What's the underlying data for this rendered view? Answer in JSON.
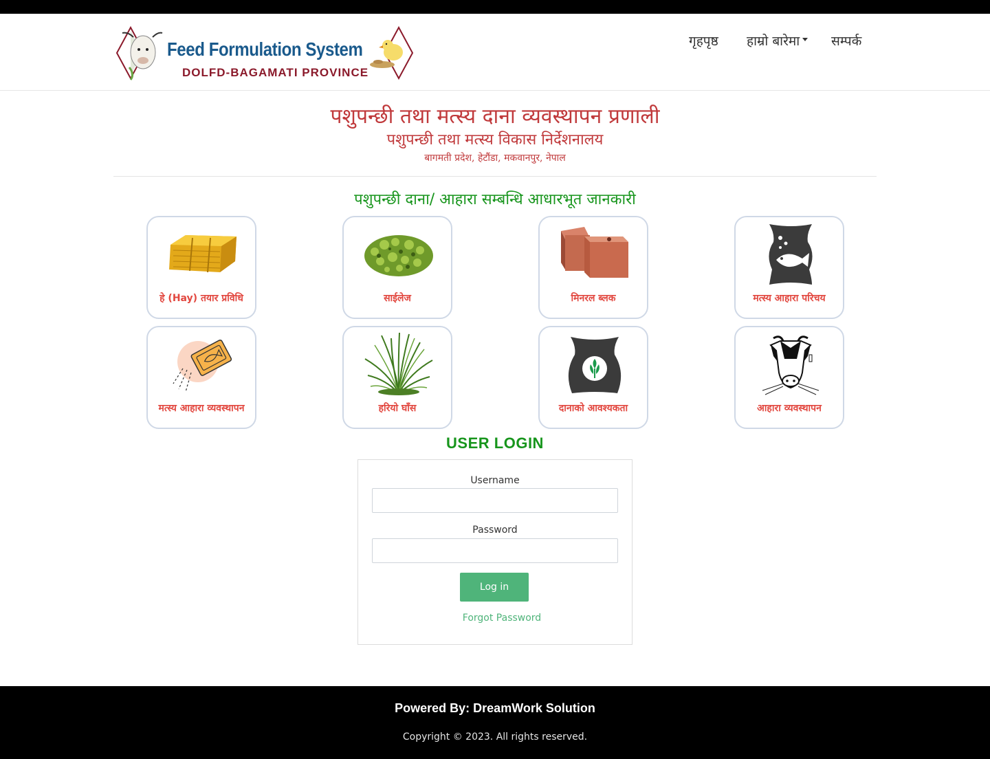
{
  "logo": {
    "title": "Feed Formulation System",
    "subtitle": "DOLFD-BAGAMATI PROVINCE"
  },
  "nav": {
    "home": "गृहपृष्ठ",
    "about": "हाम्रो बारेमा",
    "contact": "सम्पर्क"
  },
  "hero": {
    "title": "पशुपन्छी तथा मत्स्य दाना व्यवस्थापन प्रणाली",
    "subtitle": "पशुपन्छी तथा मत्स्य विकास निर्देशनालय",
    "address": "बागमती प्रदेश, हेटौंडा, मकवानपुर, नेपाल"
  },
  "section": {
    "title": "पशुपन्छी दाना/ आहारा सम्बन्धि आधारभूत जानकारी"
  },
  "cards": [
    {
      "label": "हे (Hay) तयार प्रविधि",
      "icon": "hay-bale-icon"
    },
    {
      "label": "साईलेज",
      "icon": "silage-icon"
    },
    {
      "label": "मिनरल ब्लक",
      "icon": "mineral-block-icon"
    },
    {
      "label": "मत्स्य आहारा परिचय",
      "icon": "fish-feed-bag-icon"
    },
    {
      "label": "मत्स्य आहारा व्यवस्थापन",
      "icon": "fish-feed-packet-icon"
    },
    {
      "label": "हरियो घाँस",
      "icon": "green-grass-icon"
    },
    {
      "label": "दानाको आवश्यकता",
      "icon": "grain-sack-icon"
    },
    {
      "label": "आहारा व्यवस्थापन",
      "icon": "cow-icon"
    }
  ],
  "login": {
    "title": "USER LOGIN",
    "username_label": "Username",
    "username_value": "",
    "password_label": "Password",
    "password_value": "",
    "button": "Log in",
    "forgot": "Forgot Password"
  },
  "footer": {
    "powered": "Powered By: DreamWork Solution",
    "copyright": "Copyright © 2023. All rights reserved."
  },
  "colors": {
    "brand_red": "#c0393b",
    "card_label": "#e2473f",
    "accent_green": "#17951c",
    "button_green": "#4fb47a",
    "logo_blue": "#1a5a8c"
  }
}
